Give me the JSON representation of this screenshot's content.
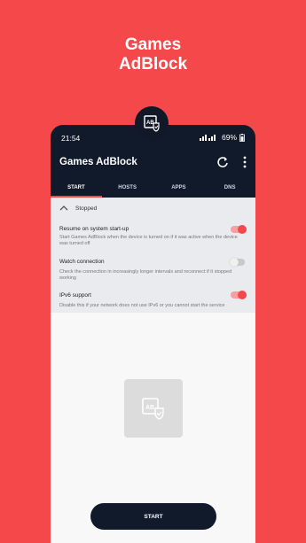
{
  "promo": {
    "title_line1": "Games",
    "title_line2": "AdBlock"
  },
  "status_bar": {
    "time": "21:54",
    "battery": "69%"
  },
  "app_bar": {
    "title": "Games AdBlock"
  },
  "tabs": [
    {
      "label": "START",
      "active": true
    },
    {
      "label": "HOSTS",
      "active": false
    },
    {
      "label": "APPS",
      "active": false
    },
    {
      "label": "DNS",
      "active": false
    }
  ],
  "state": {
    "label": "Stopped"
  },
  "settings": [
    {
      "title": "Resume on system start-up",
      "description": "Start Games AdBlock when the device is turned on if it was active when the device was turned off",
      "enabled": true
    },
    {
      "title": "Watch connection",
      "description": "Check the connection in increasingly longer intervals and reconnect if it stopped working",
      "enabled": false
    },
    {
      "title": "IPv6 support",
      "description": "Disable this if your network does not use IPv6 or you cannot start the service",
      "enabled": true
    }
  ],
  "start_button": {
    "label": "START"
  },
  "colors": {
    "accent": "#f4484a",
    "dark": "#111a2b"
  }
}
